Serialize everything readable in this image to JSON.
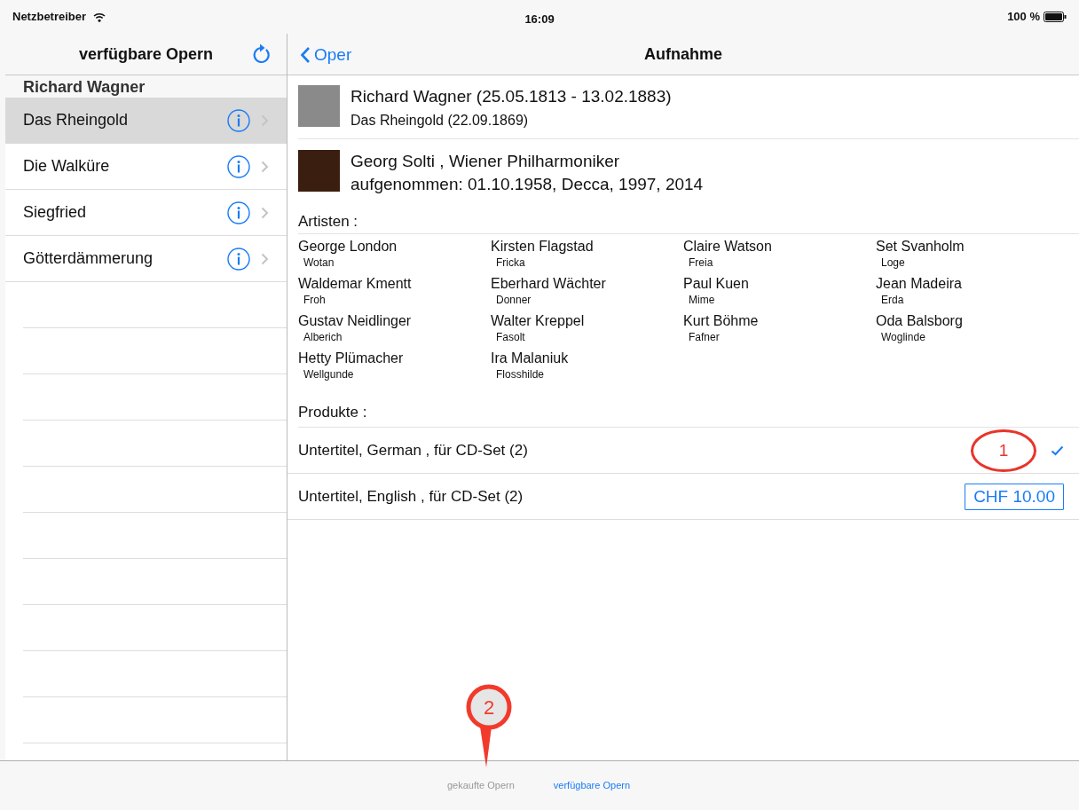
{
  "status_bar": {
    "carrier": "Netzbetreiber",
    "time": "16:09",
    "battery": "100 %"
  },
  "master": {
    "title": "verfügbare Opern",
    "section": "Richard Wagner",
    "items": [
      {
        "label": "Das Rheingold",
        "selected": true
      },
      {
        "label": "Die Walküre",
        "selected": false
      },
      {
        "label": "Siegfried",
        "selected": false
      },
      {
        "label": "Götterdämmerung",
        "selected": false
      }
    ]
  },
  "detail": {
    "back": "Oper",
    "title": "Aufnahme",
    "composer": "Richard Wagner (25.05.1813 - 13.02.1883)",
    "work": "Das Rheingold (22.09.1869)",
    "recording_line1": "Georg Solti , Wiener Philharmoniker",
    "recording_line2": "aufgenommen: 01.10.1958, Decca, 1997, 2014",
    "artists_heading": "Artisten :",
    "artists": [
      {
        "name": "George London",
        "role": "Wotan"
      },
      {
        "name": "Kirsten Flagstad",
        "role": "Fricka"
      },
      {
        "name": "Claire Watson",
        "role": "Freia"
      },
      {
        "name": "Set Svanholm",
        "role": "Loge"
      },
      {
        "name": "Waldemar Kmentt",
        "role": "Froh"
      },
      {
        "name": "Eberhard Wächter",
        "role": "Donner"
      },
      {
        "name": "Paul Kuen",
        "role": "Mime"
      },
      {
        "name": "Jean Madeira",
        "role": "Erda"
      },
      {
        "name": "Gustav Neidlinger",
        "role": "Alberich"
      },
      {
        "name": "Walter Kreppel",
        "role": "Fasolt"
      },
      {
        "name": "Kurt Böhme",
        "role": "Fafner"
      },
      {
        "name": "Oda Balsborg",
        "role": "Woglinde"
      },
      {
        "name": "Hetty Plümacher",
        "role": "Wellgunde"
      },
      {
        "name": "Ira Malaniuk",
        "role": "Flosshilde"
      }
    ],
    "products_heading": "Produkte :",
    "products": [
      {
        "kind": "purchased",
        "label": "Untertitel, German , für CD-Set (2)"
      },
      {
        "kind": "price",
        "label": "Untertitel, English , für CD-Set (2)",
        "price": "CHF 10.00"
      }
    ]
  },
  "tabs": [
    {
      "label": "gekaufte Opern",
      "selected": false
    },
    {
      "label": "verfügbare Opern",
      "selected": true
    }
  ],
  "annotations": [
    {
      "kind": "circle",
      "text": "1"
    },
    {
      "kind": "pin",
      "text": "2"
    }
  ]
}
